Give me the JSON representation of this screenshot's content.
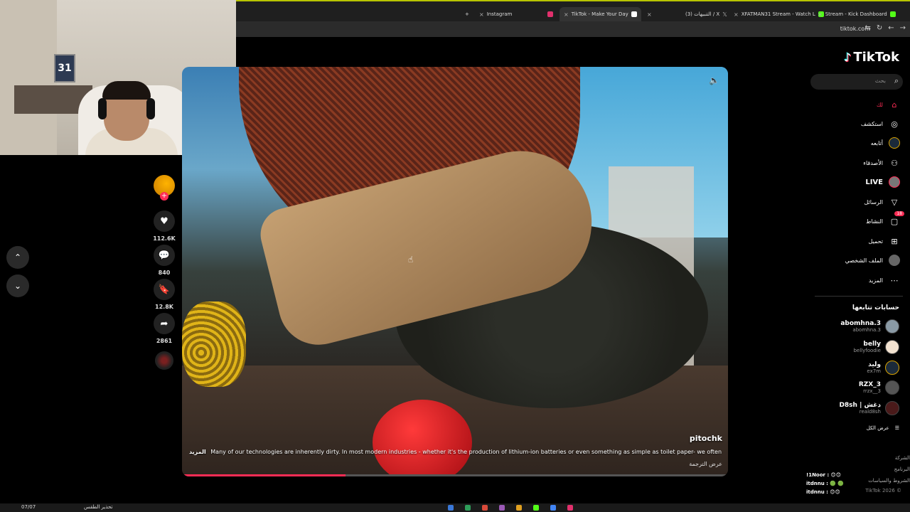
{
  "browser": {
    "tabs": [
      {
        "label": "Instagram",
        "color": "#e1306c"
      },
      {
        "label": "TikTok - Make Your Day",
        "color": "#ffffff",
        "active": true
      },
      {
        "label": "(3) التنبيهات / X",
        "color": "#ffffff"
      },
      {
        "label": "XFATMAN31 Stream - Watch L",
        "color": "#53fc18"
      },
      {
        "label": "Stream - Kick Dashboard",
        "color": "#53fc18"
      }
    ],
    "url": "tiktok.com"
  },
  "webcam": {
    "frame_text": "31"
  },
  "navigation": {
    "up_icon": "chevron-up-icon",
    "down_icon": "chevron-down-icon"
  },
  "actions": {
    "likes": "112.6K",
    "comments": "840",
    "saves": "12.8K",
    "shares": "2861"
  },
  "video": {
    "author": "pitochk",
    "more_label": "المزيد",
    "caption": "Many of our technologies are inherently dirty. In most modern industries - whether it's the production of lithium-ion batteries or even something as simple as toilet paper- we often",
    "translate_label": "عرض الترجمة",
    "progress": 0.3
  },
  "sidebar": {
    "logo": "TikTok",
    "search_placeholder": "بحث",
    "nav": [
      {
        "label": "لك",
        "icon": "home-icon"
      },
      {
        "label": "استكشف",
        "icon": "compass-icon"
      },
      {
        "label": "أتابعه",
        "icon": "following-icon"
      },
      {
        "label": "الأصدقاء",
        "icon": "friends-icon"
      },
      {
        "label": "LIVE",
        "icon": "live-icon"
      },
      {
        "label": "الرسائل",
        "icon": "messages-icon"
      },
      {
        "label": "النشاط",
        "icon": "activity-icon",
        "badge": "18"
      },
      {
        "label": "تحميل",
        "icon": "upload-icon"
      },
      {
        "label": "الملف الشخصي",
        "icon": "profile-icon"
      },
      {
        "label": "المزيد",
        "icon": "more-icon"
      }
    ],
    "following_title": "حسابات تتابعها",
    "following": [
      {
        "name": "abomhna.3",
        "handle": "abomhna.3"
      },
      {
        "name": "belly",
        "handle": "bellyfoodie"
      },
      {
        "name": "وليد",
        "handle": "ex7m"
      },
      {
        "name": "RZX_3",
        "handle": "rrzx__3"
      },
      {
        "name": "D8sh | دغش",
        "handle": "reald8sh"
      }
    ],
    "see_all": "عرض الكل",
    "footer": [
      "الشركة",
      "البرنامج",
      "الشروط والسياسات"
    ],
    "copyright": "TikTok 2026 ©"
  },
  "chat": [
    {
      "user": "!1Noor :",
      "msg": "😊😊"
    },
    {
      "user": "itdnnu :",
      "msg": "🟢 🟢"
    },
    {
      "user": "itdnnu :",
      "msg": "😊😊"
    }
  ],
  "taskbar": {
    "left_label": "تحذير الطقس",
    "time": "07/07"
  }
}
